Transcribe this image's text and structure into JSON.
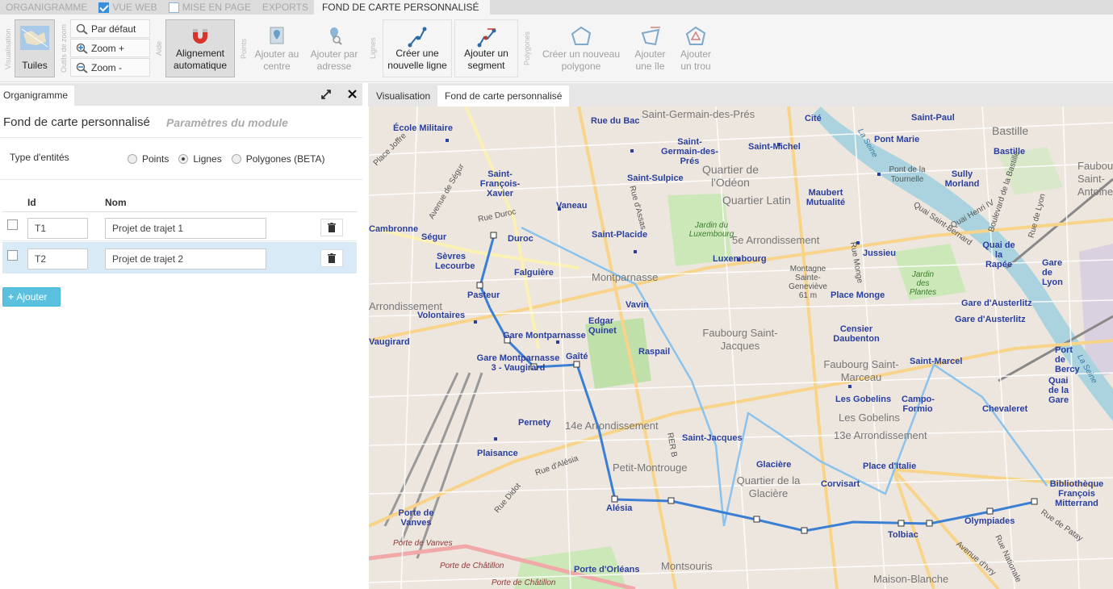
{
  "tabs": [
    {
      "label": "ORGANIGRAMME",
      "checkbox": false
    },
    {
      "label": "VUE WEB",
      "checkbox": true,
      "checked": true
    },
    {
      "label": "MISE EN PAGE",
      "checkbox": true,
      "checked": false
    },
    {
      "label": "EXPORTS",
      "checkbox": false
    },
    {
      "label": "FOND DE CARTE PERSONNALISÉ",
      "checkbox": false,
      "active": true
    }
  ],
  "ribbon": {
    "groups": {
      "visualisation": "Visualisation",
      "zoom": "Outils de zoom",
      "aide": "Aide",
      "points": "Points",
      "lignes": "Lignes",
      "polygones": "Polygones"
    },
    "tuiles": "Tuiles",
    "par_defaut": "Par défaut",
    "zoom_plus": "Zoom +",
    "zoom_minus": "Zoom -",
    "alignement": "Alignement automatique",
    "ajouter_centre": "Ajouter au centre",
    "ajouter_adresse": "Ajouter par adresse",
    "creer_ligne": "Créer une nouvelle ligne",
    "ajouter_segment": "Ajouter un segment",
    "creer_polygone": "Créer un nouveau polygone",
    "ajouter_ile": "Ajouter une île",
    "ajouter_trou": "Ajouter un trou"
  },
  "left_panel": {
    "tab": "Organigramme",
    "title": "Fond de carte personnalisé",
    "subtitle": "Paramètres du module",
    "entity_type_label": "Type d'entités",
    "entity_options": [
      {
        "label": "Points",
        "checked": false
      },
      {
        "label": "Lignes",
        "checked": true
      },
      {
        "label": "Polygones (BETA)",
        "checked": false
      }
    ],
    "columns": {
      "id": "Id",
      "nom": "Nom"
    },
    "rows": [
      {
        "id": "T1",
        "nom": "Projet de trajet 1",
        "checked": false
      },
      {
        "id": "T2",
        "nom": "Projet de trajet 2",
        "checked": true
      }
    ],
    "add_button": "Ajouter"
  },
  "right_panel": {
    "tabs": [
      {
        "label": "Visualisation"
      },
      {
        "label": "Fond de carte personnalisé",
        "active": true
      }
    ]
  },
  "map": {
    "labels": {
      "saint_germain": "Saint-Germain-des-Prés",
      "ecole_militaire": "École Militaire",
      "rue_du_bac": "Rue du Bac",
      "cite": "Cité",
      "saint_paul": "Saint-Paul",
      "bastille": "Bastille",
      "saint_michel": "Saint-Michel",
      "sg_des_pres": "Saint-Germain-des-Prés",
      "quartier_odeon": "Quartier de l'Odéon",
      "pont_marie": "Pont Marie",
      "pont_tournelle": "Pont de la Tournelle",
      "faubourg_antoine": "Faubourg Saint-Antoine",
      "saint_francois": "Saint-François-Xavier",
      "saint_sulpice": "Saint-Sulpice",
      "maubert": "Maubert Mutualité",
      "sully": "Sully Morland",
      "quartier_latin": "Quartier Latin",
      "vaneau": "Vaneau",
      "rue_duroc": "Rue Duroc",
      "cambronne": "Cambronne",
      "segur": "Ségur",
      "duroc": "Duroc",
      "saint_placide": "Saint-Placide",
      "jardin_lux": "Jardin du Luxembourg",
      "arrondissement_5": "5e Arrondissement",
      "jussieu": "Jussieu",
      "quai_rapee": "Quai de la Rapée",
      "sevres": "Sèvres Lecourbe",
      "falguiere": "Falguière",
      "montparnasse": "Montparnasse",
      "luxembourg": "Luxembourg",
      "montagne": "Montagne Sainte-Geneviève 61 m",
      "jardin_plantes": "Jardin des Plantes",
      "gare_lyon": "Gare de Lyon",
      "pasteur": "Pasteur",
      "vavin": "Vavin",
      "place_monge": "Place Monge",
      "gare_austerlitz": "Gare d'Austerlitz",
      "volontaires": "Volontaires",
      "edgar": "Edgar Quinet",
      "censier": "Censier Daubenton",
      "gare_montparnasse": "Gare Montparnasse",
      "faubourg_jacques": "Faubourg Saint-Jacques",
      "raspail": "Raspail",
      "gaite": "Gaîté",
      "gm_vaugirard": "Gare Montparnasse 3 - Vaugirard",
      "faubourg_marceau": "Faubourg Saint-Marceau",
      "saint_marcel": "Saint-Marcel",
      "port_bercy": "Port de Bercy",
      "gobelins_m": "Les Gobelins",
      "campo": "Campo-Formio",
      "quai_gare": "Quai de la Gare",
      "chevaleret": "Chevaleret",
      "pernety": "Pernety",
      "arrondissement_14": "14e Arrondissement",
      "les_gobelins": "Les Gobelins",
      "arrondissement_13": "13e Arrondissement",
      "saint_jacques": "Saint-Jacques",
      "plaisance": "Plaisance",
      "petit_montrouge": "Petit-Montrouge",
      "glaciere": "Glacière",
      "place_italie": "Place d'Italie",
      "quartier_glaciere": "Quartier de la Glacière",
      "corvisart": "Corvisart",
      "rue_alesia": "Rue d'Alésia",
      "alesia": "Alésia",
      "bibliotheque": "Bibliothèque François Mitterrand",
      "porte_vanves_m": "Porte de Vanves",
      "olympiades": "Olympiades",
      "tolbiac": "Tolbiac",
      "porte_vanves": "Porte de Vanves",
      "porte_chatillon": "Porte de Châtillon",
      "porte_orleans": "Porte d'Orléans",
      "montsouris": "Montsouris",
      "maison_blanche": "Maison-Blanche",
      "avenue_segur": "Avenue de Ségur",
      "rue_assas": "Rue d'Assas",
      "rue_lyon": "Rue de Lyon",
      "boulevard_bastille": "Boulevard de la Bastille",
      "quai_henri": "Quai Henri IV",
      "quai_bernard": "Quai Saint-Bernard",
      "rue_monge": "Rue Monge",
      "rue_patay": "Rue de Patay",
      "avenue_ivry": "Avenue d'Ivry",
      "rue_nationale": "Rue Nationale",
      "rue_didot": "Rue Didot",
      "place_joffre": "Place Joffre",
      "rer_b": "RER B",
      "arrondissement_15": "Arrondissement",
      "vaugirard_w": "Vaugirard",
      "la_seine": "La Seine",
      "la_seine2": "La Seine"
    }
  },
  "colors": {
    "route_selected": "#3a7fd4",
    "route_other": "#8cc3ec",
    "add_btn": "#5bc0de"
  }
}
